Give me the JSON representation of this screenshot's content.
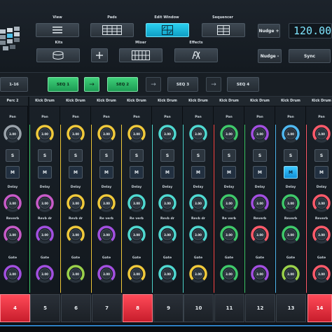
{
  "toolbar": {
    "view_label": "View",
    "pads_label": "Pads",
    "edit_window_label": "Edit Window",
    "sequencer_label": "Sequencer",
    "kits_label": "Kits",
    "mixer_label": "Mixer",
    "effects_label": "Effects",
    "nudge_plus": "Nudge +",
    "nudge_minus": "Nudge -",
    "sync_label": "Sync",
    "tempo": "120.000"
  },
  "sequence_bar": {
    "range_label": "1-16",
    "items": [
      "SEQ 1",
      "SEQ 2",
      "SEQ 3",
      "SEQ 4"
    ]
  },
  "strips": [
    {
      "name": "Perc 2",
      "knob_color": "#9aa3ab"
    },
    {
      "name": "Kick Drum",
      "knob_color": "#f0c93a"
    },
    {
      "name": "Kick Drum",
      "knob_color": "#f0c93a"
    },
    {
      "name": "Kick Drum",
      "knob_color": "#f0c93a"
    },
    {
      "name": "Kick Drum",
      "knob_color": "#f0c93a"
    },
    {
      "name": "Kick Drum",
      "knob_color": "#4fd8d0"
    },
    {
      "name": "Kick Drum",
      "knob_color": "#4fd8d0"
    },
    {
      "name": "Kick Drum",
      "knob_color": "#3fc86a"
    },
    {
      "name": "Kick Drum",
      "knob_color": "#a24fe0"
    },
    {
      "name": "Kick Drum",
      "knob_color": "#4fb8f0"
    },
    {
      "name": "Kick Drum",
      "knob_color": "#ff5a6a"
    }
  ],
  "strip_labels": {
    "pan": "Pan",
    "solo": "S",
    "mute": "M",
    "delay": "Delay",
    "reverb": "Reverb",
    "gate": "Gate",
    "knob_value": "3.00"
  },
  "reverb_variants": [
    "Reverb",
    "Revb dr",
    "Revb dr",
    "Re verb",
    "Re verb",
    "Revb dr",
    "Revb dr",
    "Re verb",
    "Reverb",
    "Reverb",
    "Reverb"
  ],
  "channels": [
    "4",
    "5",
    "6",
    "7",
    "8",
    "9",
    "10",
    "11",
    "12",
    "13",
    "14"
  ],
  "colors": {
    "accent": "#21c4ec",
    "green": "#2ec86a",
    "red": "#e8323f",
    "mute_on": "#24a8ec"
  },
  "mute_on_index": 9,
  "red_channels": [
    "4",
    "8",
    "14"
  ]
}
